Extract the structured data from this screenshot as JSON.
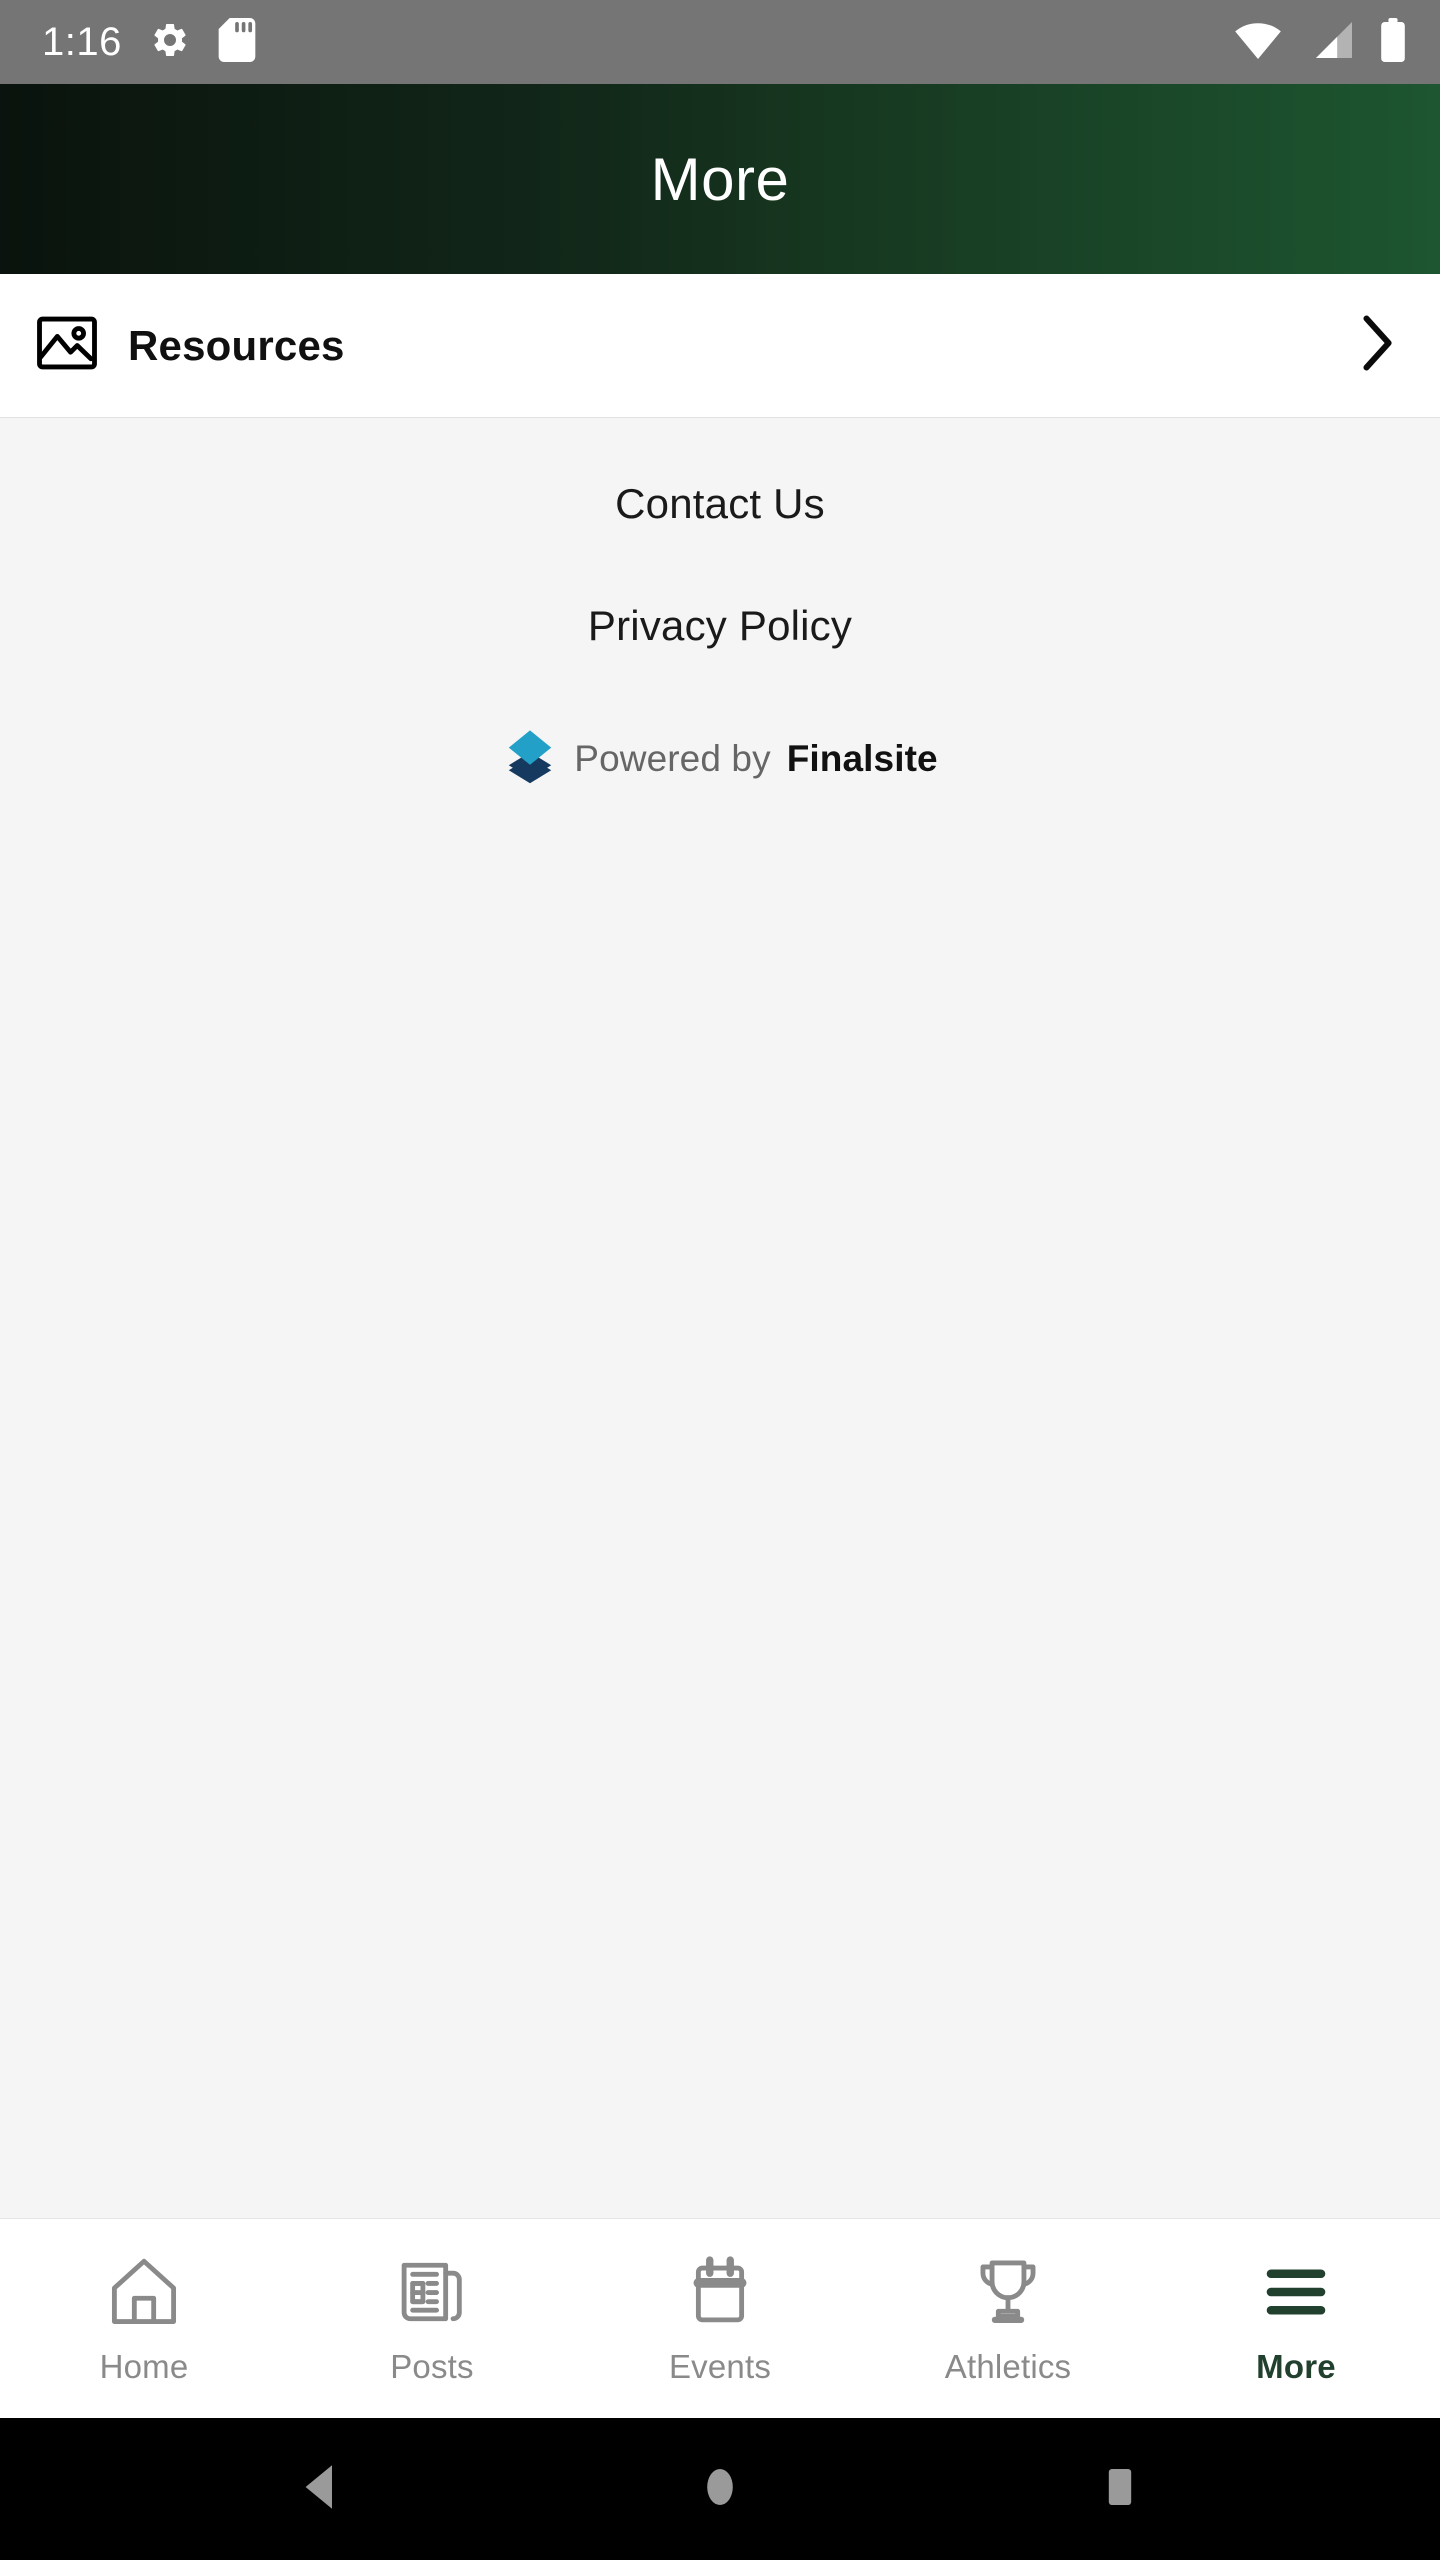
{
  "status_bar": {
    "time": "1:16",
    "left_icons": [
      {
        "name": "settings-gear-icon"
      },
      {
        "name": "sd-card-icon"
      }
    ],
    "right_icons": [
      {
        "name": "wifi-icon"
      },
      {
        "name": "cellular-signal-icon"
      },
      {
        "name": "battery-icon"
      }
    ],
    "background_color": "#757575",
    "foreground_color": "#ffffff"
  },
  "header": {
    "title": "More",
    "gradient_from": "#0a130d",
    "gradient_to": "#1d5630",
    "title_color": "#ffffff"
  },
  "resources_row": {
    "label": "Resources",
    "icon": "image-photo-icon",
    "chevron": "chevron-right-icon",
    "background_color": "#ffffff"
  },
  "footer": {
    "links": [
      {
        "label": "Contact Us",
        "name": "contact-us-link"
      },
      {
        "label": "Privacy Policy",
        "name": "privacy-policy-link"
      }
    ],
    "powered_by": {
      "prefix": "Powered by",
      "brand": "Finalsite",
      "logo_top_color": "#22a0c8",
      "logo_bottom_color": "#163a5f"
    },
    "background_color": "#f5f5f5"
  },
  "tab_bar": {
    "active_color": "#22402e",
    "inactive_color": "#8a8a8a",
    "tabs": [
      {
        "label": "Home",
        "icon": "home-icon",
        "active": false
      },
      {
        "label": "Posts",
        "icon": "newspaper-icon",
        "active": false
      },
      {
        "label": "Events",
        "icon": "calendar-icon",
        "active": false
      },
      {
        "label": "Athletics",
        "icon": "trophy-icon",
        "active": false
      },
      {
        "label": "More",
        "icon": "hamburger-menu-icon",
        "active": true
      }
    ]
  },
  "android_nav": {
    "buttons": [
      {
        "name": "back-button",
        "icon": "triangle-back-icon"
      },
      {
        "name": "home-button",
        "icon": "circle-home-icon"
      },
      {
        "name": "recents-button",
        "icon": "square-recents-icon"
      }
    ],
    "background_color": "#000000",
    "icon_color": "#9a9a9a"
  }
}
